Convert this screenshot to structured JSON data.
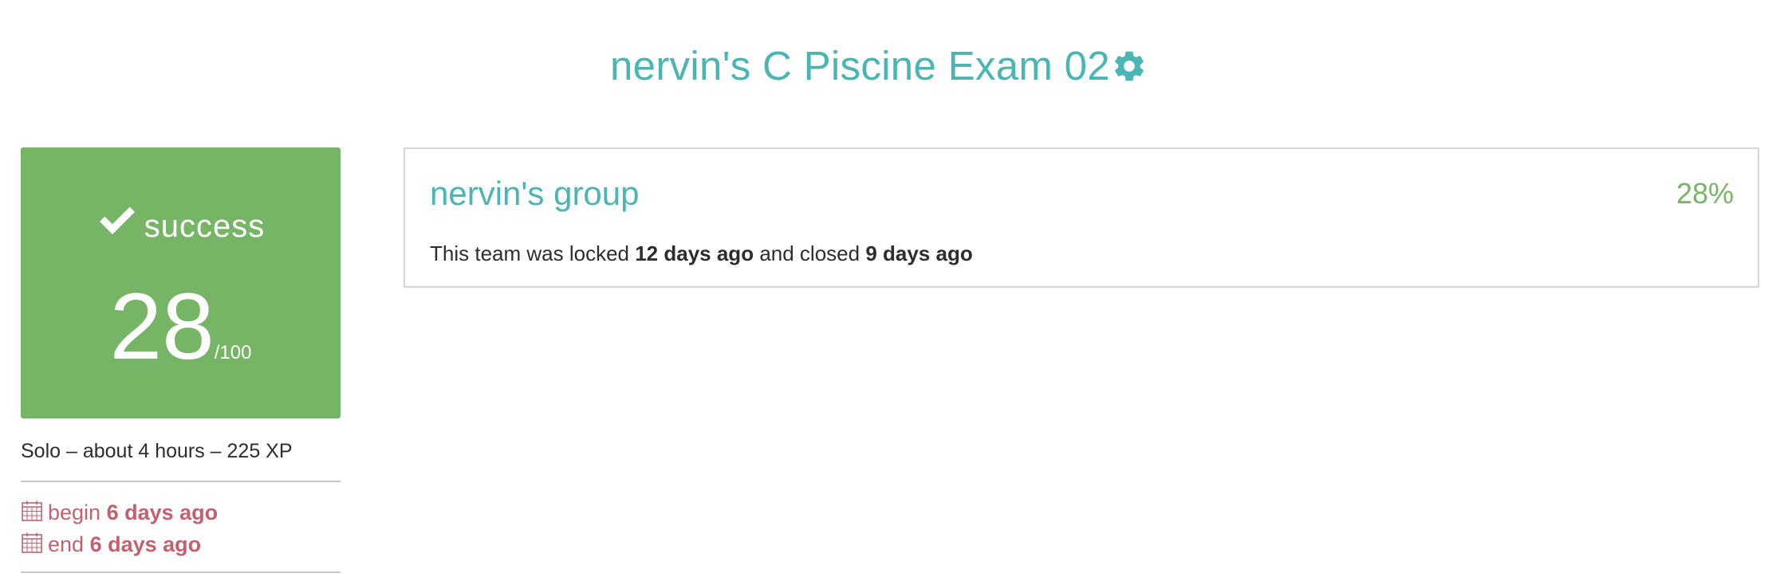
{
  "header": {
    "title": "nervin's C Piscine Exam 02",
    "settings_icon": "gear-icon",
    "title_color": "#4bb5b3"
  },
  "result": {
    "status_icon": "check-icon",
    "status": "success",
    "score": "28",
    "max_score": "/100",
    "card_color": "#75b565"
  },
  "project_info": {
    "summary": "Solo – about 4 hours – 225 XP"
  },
  "dates": {
    "icon": "calendar-icon",
    "color": "#c2616f",
    "begin_label": "begin",
    "begin_value": "6 days ago",
    "end_label": "end",
    "end_value": "6 days ago"
  },
  "team": {
    "name": "nervin's group",
    "percent": "28%",
    "locked_prefix": "This team was locked",
    "locked_value": "12 days ago",
    "closed_prefix": "and closed",
    "closed_value": "9 days ago"
  }
}
